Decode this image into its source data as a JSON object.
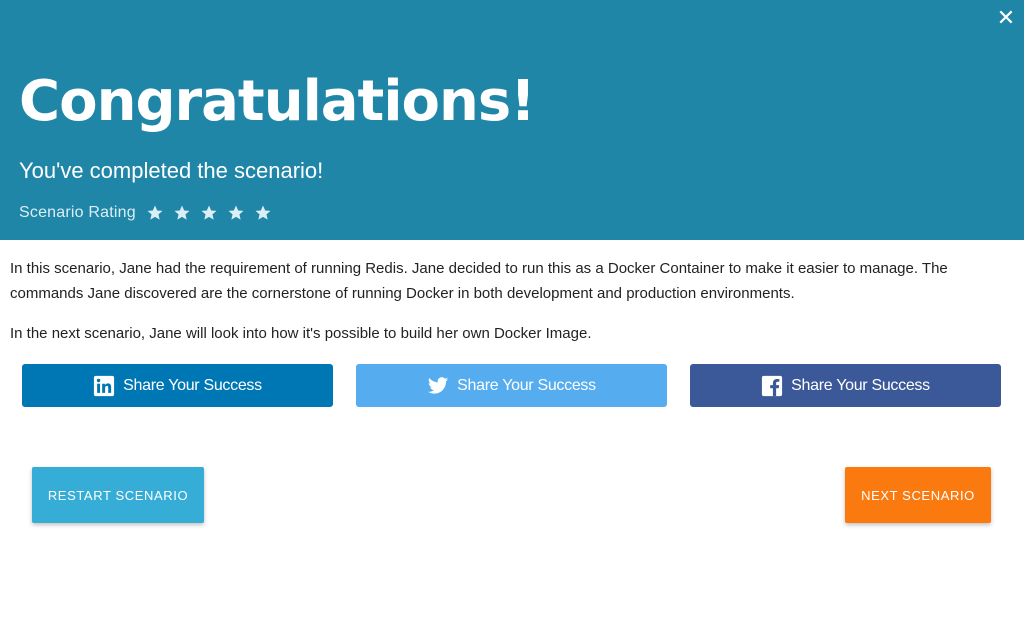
{
  "header": {
    "close_glyph": "✕",
    "title": "Congratulations!",
    "subtitle": "You've completed the scenario!",
    "rating_label": "Scenario Rating",
    "stars": 5,
    "background_color": "#1f86a8"
  },
  "body": {
    "paragraphs": [
      "In this scenario, Jane had the requirement of running Redis. Jane decided to run this as a Docker Container to make it easier to manage. The commands Jane discovered are the cornerstone of running Docker in both development and production environments.",
      "In the next scenario, Jane will look into how it's possible to build her own Docker Image."
    ]
  },
  "share": {
    "linkedin": {
      "label": "Share Your Success",
      "icon": "linkedin-icon",
      "color": "#0077b5"
    },
    "twitter": {
      "label": "Share Your Success",
      "icon": "twitter-icon",
      "color": "#55acee"
    },
    "facebook": {
      "label": "Share Your Success",
      "icon": "facebook-icon",
      "color": "#3b5998"
    }
  },
  "actions": {
    "restart_label": "RESTART SCENARIO",
    "restart_color": "#35add6",
    "next_label": "NEXT SCENARIO",
    "next_color": "#fb7a10"
  }
}
